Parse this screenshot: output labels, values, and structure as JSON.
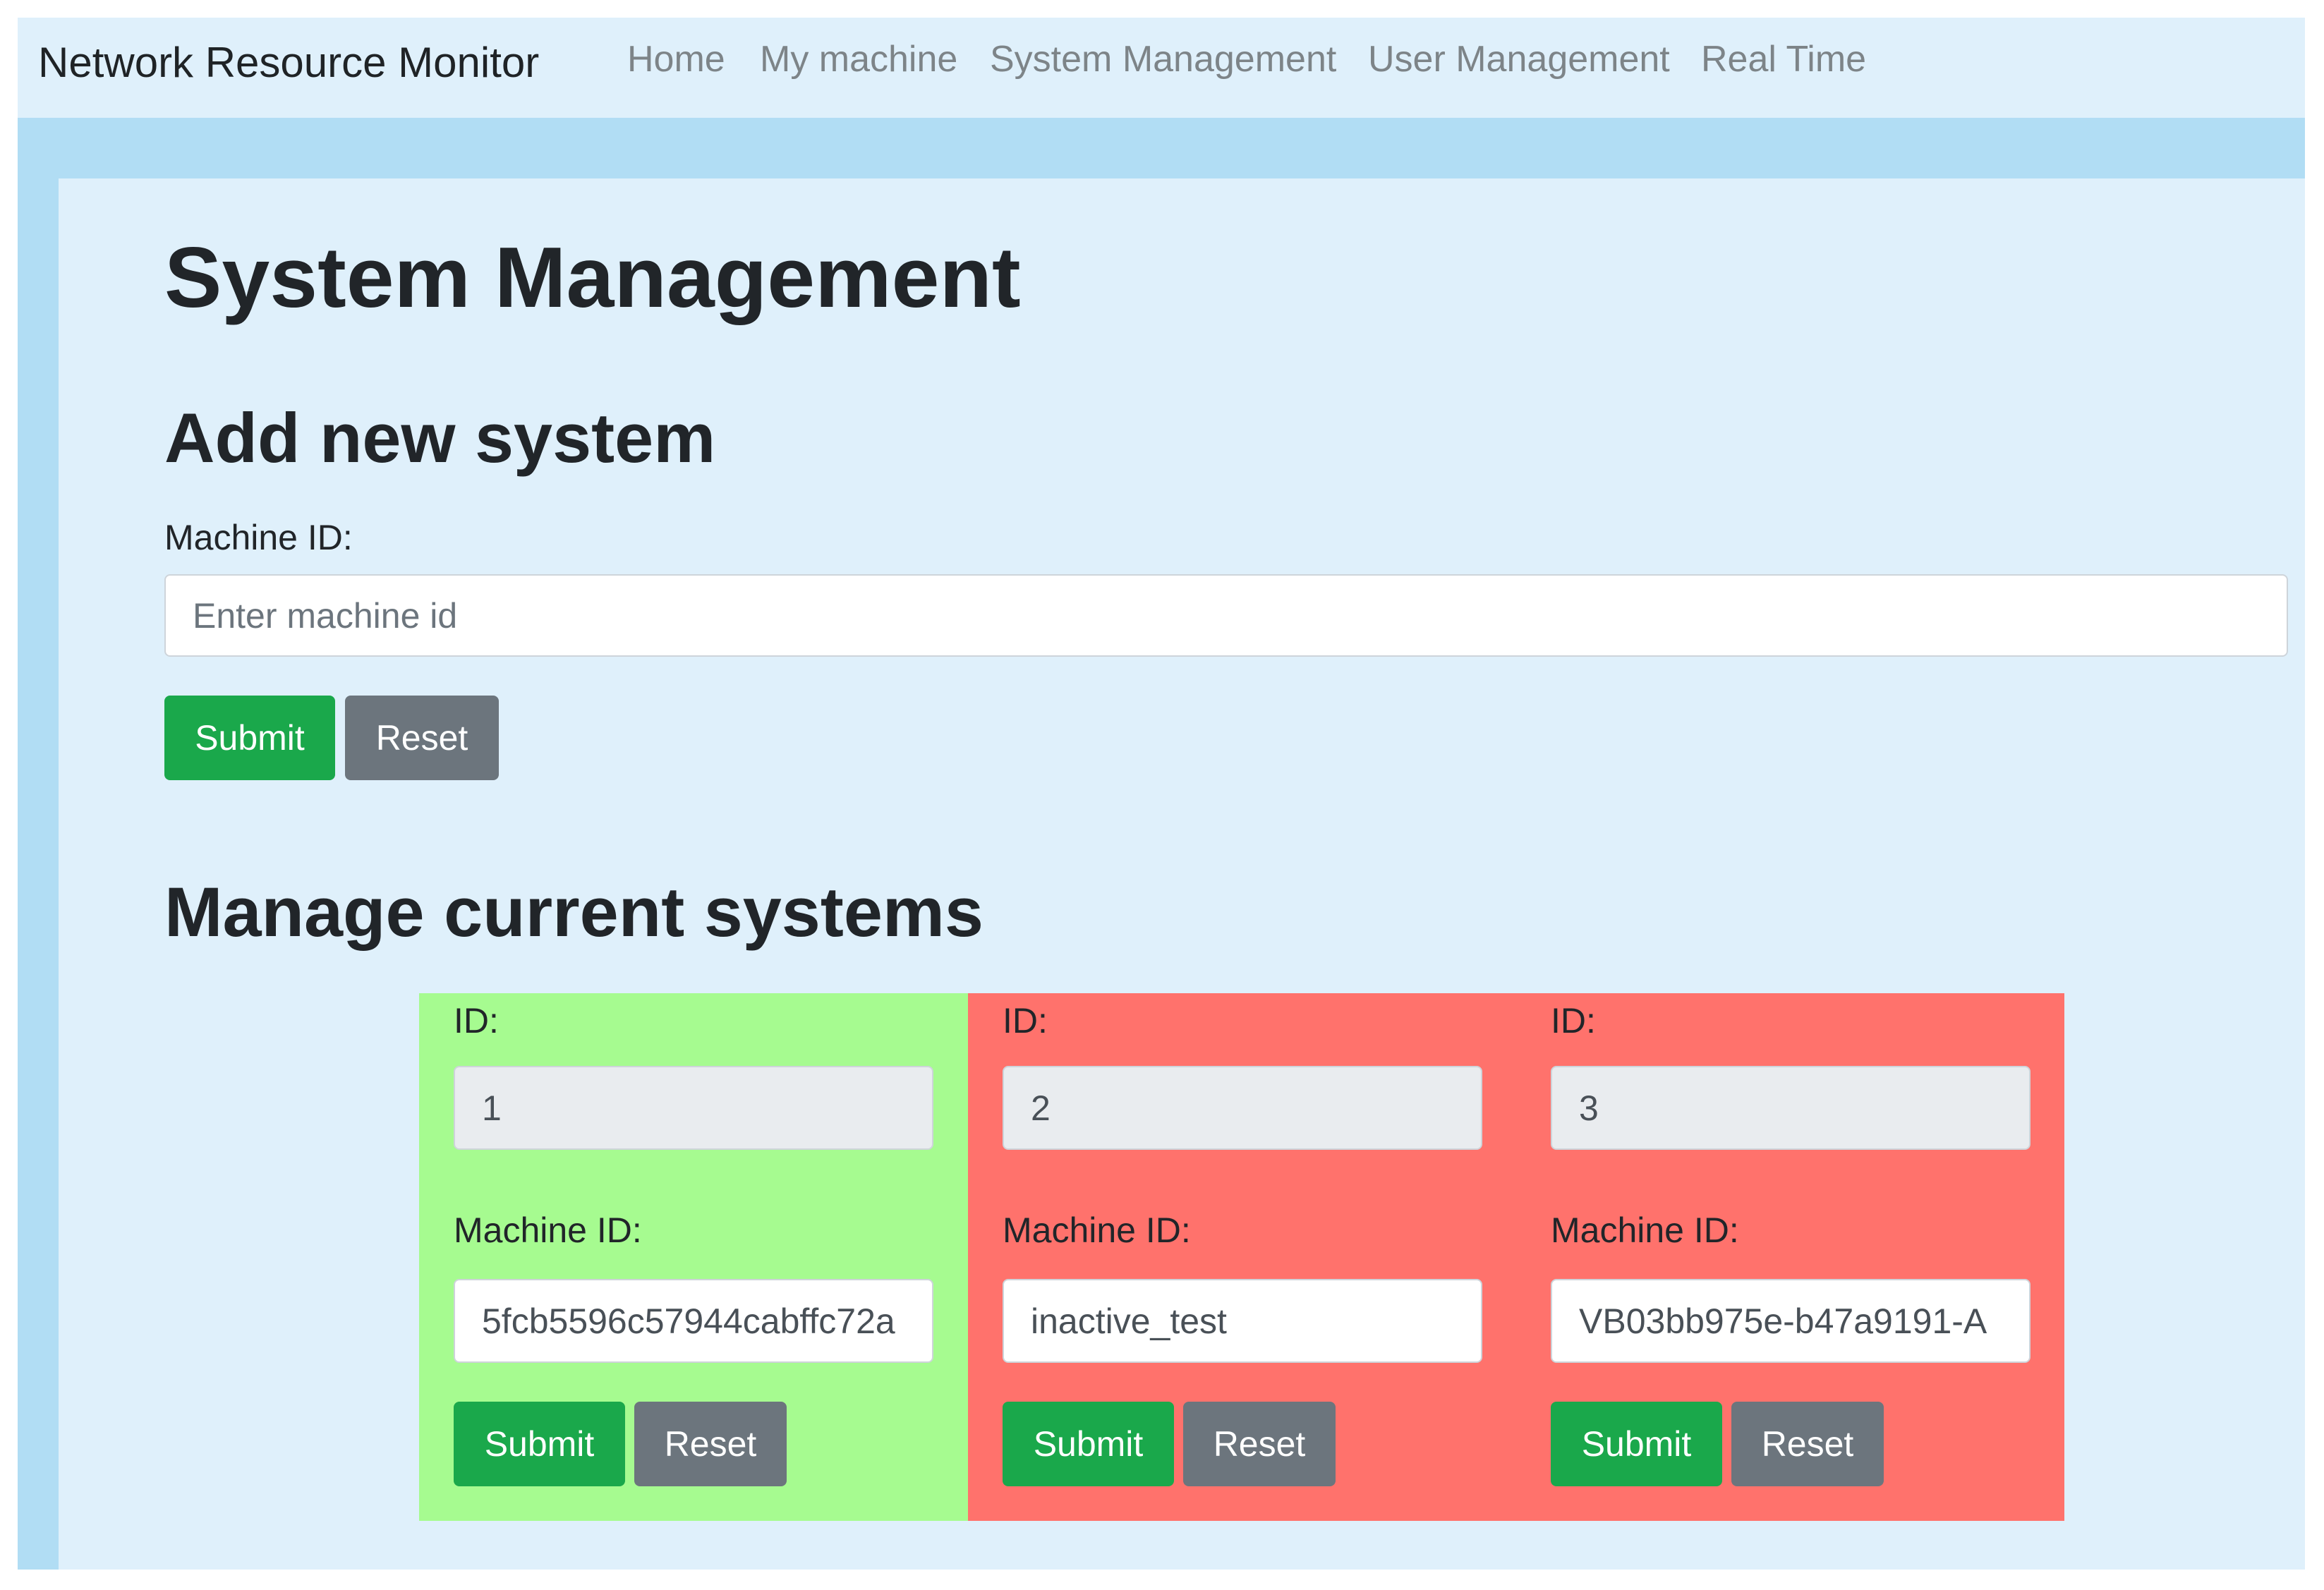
{
  "navbar": {
    "brand": "Network Resource Monitor",
    "links": [
      {
        "label": "Home"
      },
      {
        "label": "My machine"
      },
      {
        "label": "System Management"
      },
      {
        "label": "User Management"
      },
      {
        "label": "Real Time"
      }
    ]
  },
  "page": {
    "title": "System Management"
  },
  "add_system": {
    "heading": "Add new system",
    "machine_id_label": "Machine ID:",
    "machine_id_placeholder": "Enter machine id",
    "machine_id_value": "",
    "submit_label": "Submit",
    "reset_label": "Reset"
  },
  "manage_systems": {
    "heading": "Manage current systems",
    "systems": [
      {
        "id_label": "ID:",
        "id_value": "1",
        "machine_id_label": "Machine ID:",
        "machine_id_value": "5fcb5596c57944cabffc72a",
        "status": "active",
        "card_color": "#a6fb90",
        "submit_label": "Submit",
        "reset_label": "Reset"
      },
      {
        "id_label": "ID:",
        "id_value": "2",
        "machine_id_label": "Machine ID:",
        "machine_id_value": "inactive_test",
        "status": "inactive",
        "card_color": "#ff726c",
        "submit_label": "Submit",
        "reset_label": "Reset"
      },
      {
        "id_label": "ID:",
        "id_value": "3",
        "machine_id_label": "Machine ID:",
        "machine_id_value": "VB03bb975e-b47a9191-A",
        "status": "inactive",
        "card_color": "#ff726c",
        "submit_label": "Submit",
        "reset_label": "Reset"
      }
    ]
  },
  "colors": {
    "outer_frame": "#b1ddf4",
    "navbar_background": "#dff0fb",
    "content_background": "#dff0fb",
    "success_button": "#1aa84b",
    "secondary_button": "#6c757d"
  }
}
